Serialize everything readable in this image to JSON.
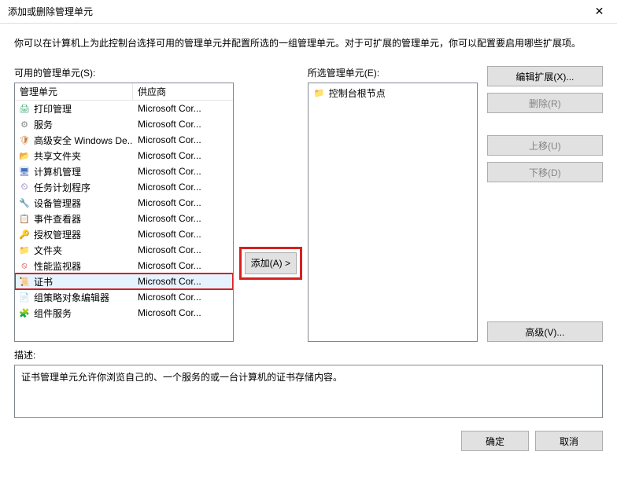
{
  "window": {
    "title": "添加或删除管理单元",
    "intro": "你可以在计算机上为此控制台选择可用的管理单元并配置所选的一组管理单元。对于可扩展的管理单元，你可以配置要启用哪些扩展项。"
  },
  "available": {
    "label": "可用的管理单元(S):",
    "header_snapin": "管理单元",
    "header_vendor": "供应商",
    "items": [
      {
        "icon": "printer-icon",
        "cls": "ic-printer",
        "name": "打印管理",
        "vendor": "Microsoft Cor..."
      },
      {
        "icon": "gear-icon",
        "cls": "ic-gear",
        "name": "服务",
        "vendor": "Microsoft Cor..."
      },
      {
        "icon": "shield-icon",
        "cls": "ic-shield",
        "name": "高级安全 Windows De...",
        "vendor": "Microsoft Cor..."
      },
      {
        "icon": "shared-folder-icon",
        "cls": "ic-folder",
        "name": "共享文件夹",
        "vendor": "Microsoft Cor..."
      },
      {
        "icon": "computer-icon",
        "cls": "ic-computer",
        "name": "计算机管理",
        "vendor": "Microsoft Cor..."
      },
      {
        "icon": "clock-icon",
        "cls": "ic-clock",
        "name": "任务计划程序",
        "vendor": "Microsoft Cor..."
      },
      {
        "icon": "device-icon",
        "cls": "ic-devmgr",
        "name": "设备管理器",
        "vendor": "Microsoft Cor..."
      },
      {
        "icon": "event-icon",
        "cls": "ic-event",
        "name": "事件查看器",
        "vendor": "Microsoft Cor..."
      },
      {
        "icon": "auth-icon",
        "cls": "ic-auth",
        "name": "授权管理器",
        "vendor": "Microsoft Cor..."
      },
      {
        "icon": "folder-icon",
        "cls": "ic-folder2",
        "name": "文件夹",
        "vendor": "Microsoft Cor..."
      },
      {
        "icon": "perf-icon",
        "cls": "ic-perf",
        "name": "性能监视器",
        "vendor": "Microsoft Cor..."
      },
      {
        "icon": "cert-icon",
        "cls": "ic-cert",
        "name": "证书",
        "vendor": "Microsoft Cor...",
        "selected": true,
        "highlighted": true
      },
      {
        "icon": "gpo-icon",
        "cls": "ic-gpo",
        "name": "组策略对象编辑器",
        "vendor": "Microsoft Cor..."
      },
      {
        "icon": "comsvc-icon",
        "cls": "ic-comsvc",
        "name": "组件服务",
        "vendor": "Microsoft Cor..."
      }
    ]
  },
  "add_button": "添加(A) >",
  "selected": {
    "label": "所选管理单元(E):",
    "root": "控制台根节点"
  },
  "buttons": {
    "edit_ext": "编辑扩展(X)...",
    "remove": "删除(R)",
    "move_up": "上移(U)",
    "move_down": "下移(D)",
    "advanced": "高级(V)...",
    "ok": "确定",
    "cancel": "取消"
  },
  "description": {
    "label": "描述:",
    "text": "证书管理单元允许你浏览自己的、一个服务的或一台计算机的证书存储内容。"
  }
}
